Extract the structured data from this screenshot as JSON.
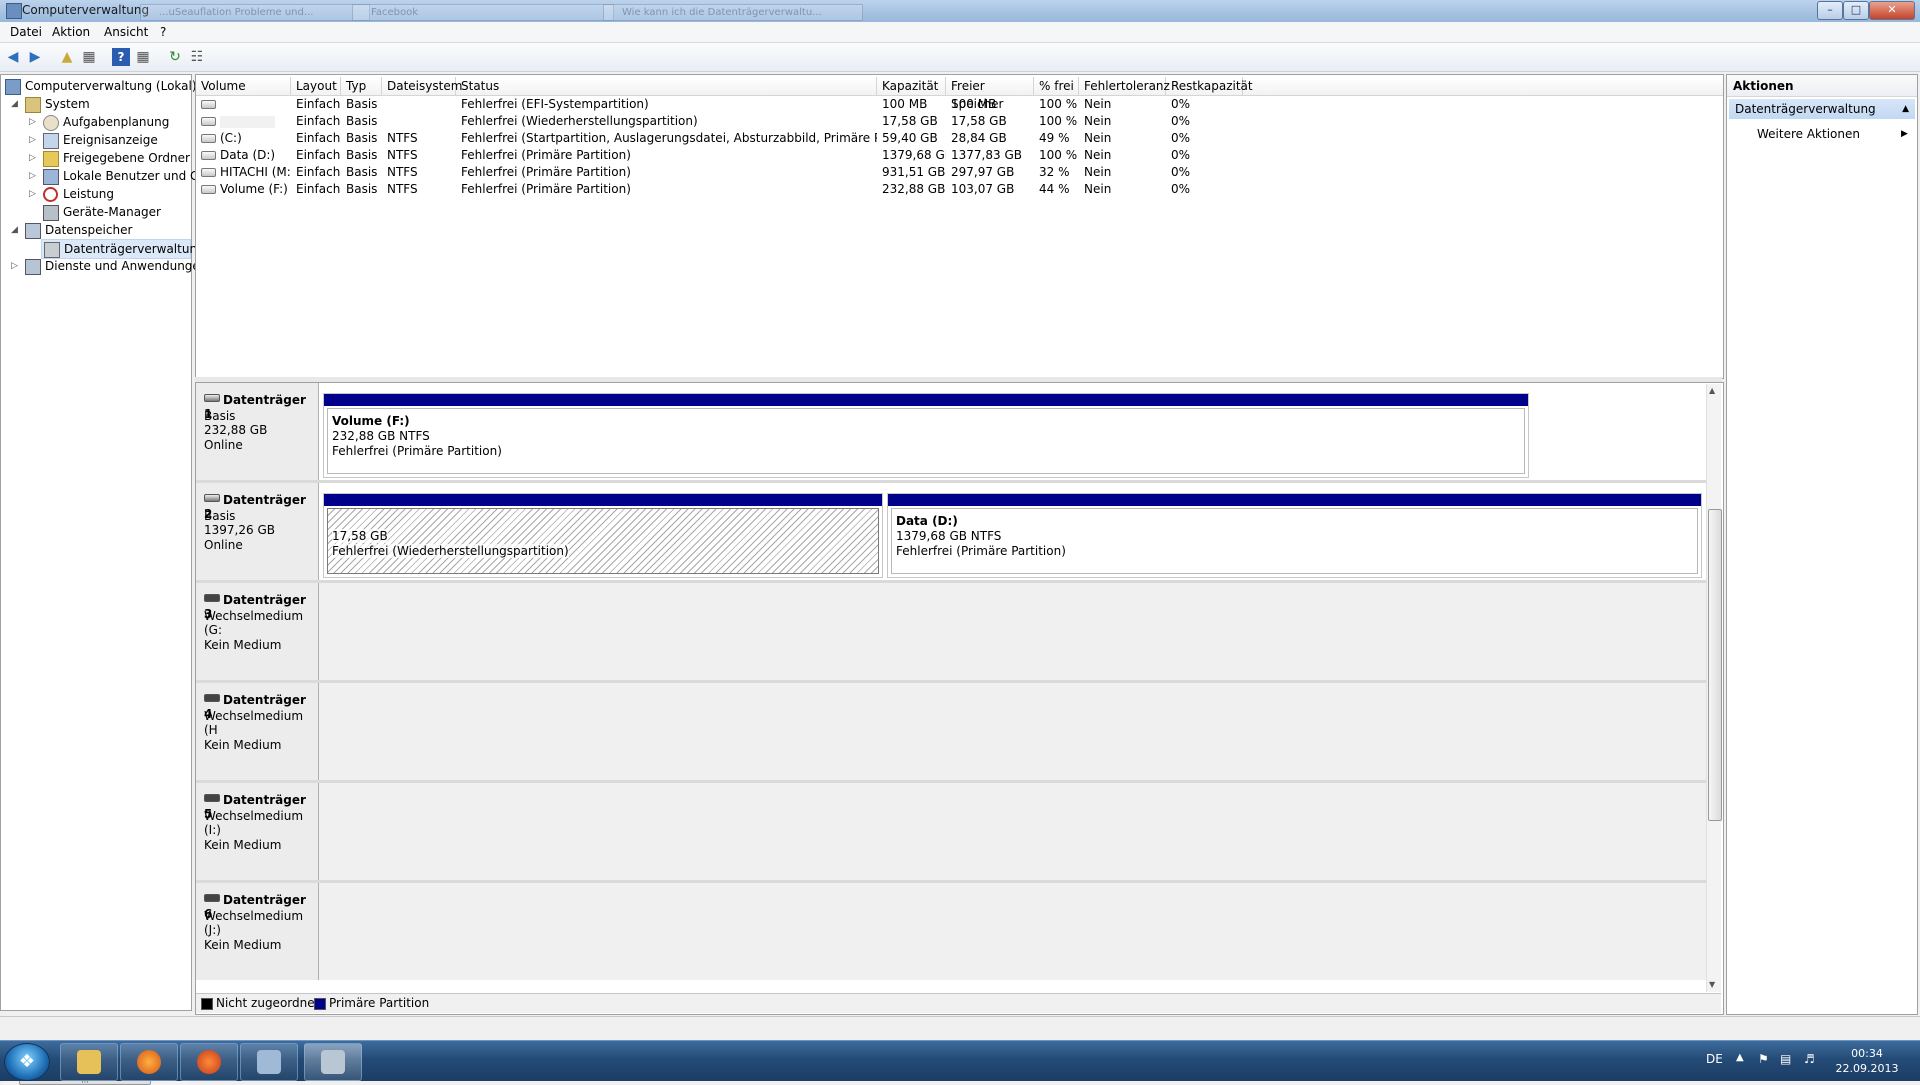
{
  "window": {
    "title": "Computerverwaltung",
    "ghost_tabs": [
      "...uSeauflation Probleme und...",
      "Facebook",
      "Wie kann ich die Datenträgerverwaltu..."
    ]
  },
  "menu": [
    "Datei",
    "Aktion",
    "Ansicht",
    "?"
  ],
  "tree": {
    "root": "Computerverwaltung (Lokal)",
    "system": "System",
    "system_children": [
      "Aufgabenplanung",
      "Ereignisanzeige",
      "Freigegebene Ordner",
      "Lokale Benutzer und Gr",
      "Leistung",
      "Geräte-Manager"
    ],
    "storage": "Datenspeicher",
    "storage_children": [
      "Datenträgerverwaltung"
    ],
    "services": "Dienste und Anwendungen",
    "scroll_grip": "|||"
  },
  "volume_table": {
    "headers": [
      "Volume",
      "Layout",
      "Typ",
      "Dateisystem",
      "Status",
      "Kapazität",
      "Freier Speicher",
      "% frei",
      "Fehlertoleranz",
      "Restkapazität"
    ],
    "rows": [
      [
        "",
        "Einfach",
        "Basis",
        "",
        "Fehlerfrei (EFI-Systempartition)",
        "100 MB",
        "100 MB",
        "100 %",
        "Nein",
        "0%"
      ],
      [
        "",
        "Einfach",
        "Basis",
        "",
        "Fehlerfrei (Wiederherstellungspartition)",
        "17,58 GB",
        "17,58 GB",
        "100 %",
        "Nein",
        "0%"
      ],
      [
        "(C:)",
        "Einfach",
        "Basis",
        "NTFS",
        "Fehlerfrei (Startpartition, Auslagerungsdatei, Absturzabbild, Primäre Partition)",
        "59,40 GB",
        "28,84 GB",
        "49 %",
        "Nein",
        "0%"
      ],
      [
        "Data (D:)",
        "Einfach",
        "Basis",
        "NTFS",
        "Fehlerfrei (Primäre Partition)",
        "1379,68 GB",
        "1377,83 GB",
        "100 %",
        "Nein",
        "0%"
      ],
      [
        "HITACHI (M:)",
        "Einfach",
        "Basis",
        "NTFS",
        "Fehlerfrei (Primäre Partition)",
        "931,51 GB",
        "297,97 GB",
        "32 %",
        "Nein",
        "0%"
      ],
      [
        "Volume (F:)",
        "Einfach",
        "Basis",
        "NTFS",
        "Fehlerfrei (Primäre Partition)",
        "232,88 GB",
        "103,07 GB",
        "44 %",
        "Nein",
        "0%"
      ]
    ]
  },
  "disks": [
    {
      "name": "Datenträger 1",
      "type": "Basis",
      "size": "232,88 GB",
      "state": "Online"
    },
    {
      "name": "Datenträger 2",
      "type": "Basis",
      "size": "1397,26 GB",
      "state": "Online"
    },
    {
      "name": "Datenträger 3",
      "type": "Wechselmedium (G:",
      "size": "",
      "state": "Kein Medium"
    },
    {
      "name": "Datenträger 4",
      "type": "Wechselmedium (H",
      "size": "",
      "state": "Kein Medium"
    },
    {
      "name": "Datenträger 5",
      "type": "Wechselmedium (I:)",
      "size": "",
      "state": "Kein Medium"
    },
    {
      "name": "Datenträger 6",
      "type": "Wechselmedium (J:)",
      "size": "",
      "state": "Kein Medium"
    }
  ],
  "partitions": {
    "d1_p1": {
      "title": "Volume  (F:)",
      "size": "232,88 GB NTFS",
      "status": "Fehlerfrei (Primäre Partition)"
    },
    "d2_p1": {
      "size": "17,58 GB",
      "status": "Fehlerfrei (Wiederherstellungspartition)"
    },
    "d2_p2": {
      "title": "Data  (D:)",
      "size": "1379,68 GB NTFS",
      "status": "Fehlerfrei (Primäre Partition)"
    }
  },
  "legend": [
    "Nicht zugeordnet",
    "Primäre Partition"
  ],
  "actions": {
    "header": "Aktionen",
    "section": "Datenträgerverwaltung",
    "more": "Weitere Aktionen"
  },
  "taskbar": {
    "lang": "DE",
    "time": "00:34",
    "date": "22.09.2013"
  },
  "colors": {
    "primary_partition": "#00008b",
    "unallocated": "#000000",
    "selection": "#dbe8f7"
  }
}
